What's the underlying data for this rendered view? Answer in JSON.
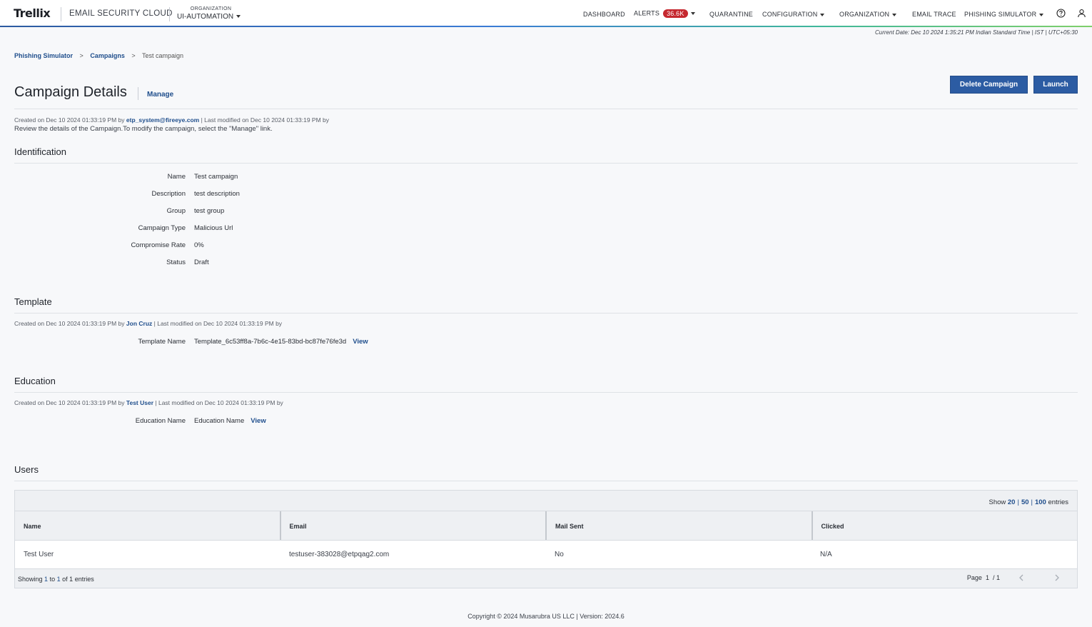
{
  "nav": {
    "logo": "Trellix",
    "product": "EMAIL SECURITY CLOUD",
    "org_label": "ORGANIZATION",
    "org_value": "UI-AUTOMATION",
    "items": {
      "dashboard": "DASHBOARD",
      "alerts": "ALERTS",
      "alerts_count": "36.6K",
      "quarantine": "QUARANTINE",
      "configuration": "CONFIGURATION",
      "organization": "ORGANIZATION",
      "email_trace": "EMAIL TRACE",
      "phishing_simulator": "PHISHING SIMULATOR"
    }
  },
  "current_date": "Current Date: Dec 10 2024 1:35:21 PM Indian Standard Time | IST | UTC+05:30",
  "breadcrumb": {
    "item1": "Phishing Simulator",
    "item2": "Campaigns",
    "current": "Test campaign",
    "sep": ">"
  },
  "page": {
    "title": "Campaign Details",
    "manage": "Manage",
    "delete_btn": "Delete Campaign",
    "launch_btn": "Launch",
    "created_prefix": "Created on Dec 10 2024 01:33:19 PM by",
    "created_by": "etp_system@fireeye.com",
    "modified": "| Last modified on Dec 10 2024 01:33:19 PM by",
    "description": "Review the details of the Campaign.To modify the campaign, select the \"Manage\" link."
  },
  "identification": {
    "title": "Identification",
    "fields": [
      {
        "label": "Name",
        "value": "Test campaign"
      },
      {
        "label": "Description",
        "value": "test description"
      },
      {
        "label": "Group",
        "value": "test group"
      },
      {
        "label": "Campaign Type",
        "value": "Malicious Url"
      },
      {
        "label": "Compromise Rate",
        "value": "0%"
      },
      {
        "label": "Status",
        "value": "Draft"
      }
    ]
  },
  "template": {
    "title": "Template",
    "created_prefix": "Created on Dec 10 2024 01:33:19 PM by",
    "created_by": "Jon Cruz",
    "modified": "| Last modified on Dec 10 2024 01:33:19 PM by",
    "label": "Template Name",
    "value": "Template_6c53ff8a-7b6c-4e15-83bd-bc87fe76fe3d",
    "view": "View"
  },
  "education": {
    "title": "Education",
    "created_prefix": "Created on Dec 10 2024 01:33:19 PM by",
    "created_by": "Test User",
    "modified": "| Last modified on Dec 10 2024 01:33:19 PM by",
    "label": "Education Name",
    "value": "Education Name",
    "view": "View"
  },
  "users": {
    "title": "Users",
    "show_label": "Show",
    "show_opts": [
      "20",
      "50",
      "100"
    ],
    "entries_label": "entries",
    "columns": [
      "Name",
      "Email",
      "Mail Sent",
      "Clicked"
    ],
    "rows": [
      [
        "Test User",
        "testuser-383028@etpqag2.com",
        "No",
        "N/A"
      ]
    ],
    "showing_prefix": "Showing",
    "showing_from": "1",
    "showing_to_label": "to",
    "showing_to": "1",
    "showing_of_label": "of",
    "showing_total": "1",
    "showing_suffix": "entries",
    "page_label": "Page",
    "page_current": "1",
    "page_total": "/ 1"
  },
  "footer": "Copyright © 2024 Musarubra US LLC | Version: 2024.6"
}
